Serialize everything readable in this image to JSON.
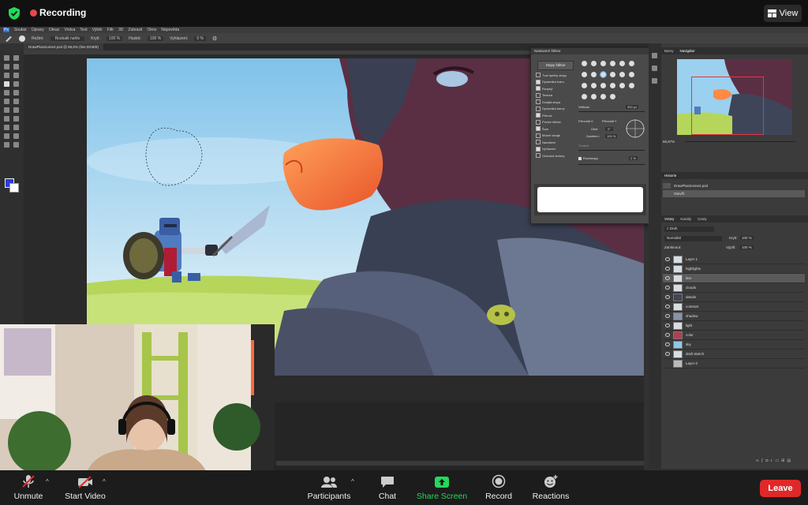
{
  "zoom": {
    "recording_label": "Recording",
    "view_label": "View",
    "toolbar": {
      "unmute": "Unmute",
      "start_video": "Start Video",
      "participants": "Participants",
      "chat": "Chat",
      "share_screen": "Share Screen",
      "record": "Record",
      "reactions": "Reactions",
      "leave": "Leave"
    },
    "colors": {
      "recording": "#e5484d",
      "share_screen": "#23d959",
      "leave": "#e02828"
    }
  },
  "photoshop": {
    "menu": [
      "Soubor",
      "Úpravy",
      "Obraz",
      "Vrstva",
      "Text",
      "Výběr",
      "Filtr",
      "3D",
      "Zobrazit",
      "Okno",
      "Nápověda"
    ],
    "options_bar": [
      "Režim:",
      "Rozbalit nahlo",
      "Krytí:",
      "100 %",
      "Hustot:",
      "100 %",
      "Vyhlazení:",
      "0 %"
    ],
    "document_tab": "DrawPlusScene2.psd @ 66,6% (line,RGB/8)",
    "foreground_color": "#2d3bd6",
    "brush_panel": {
      "title": "Nastavení štětce",
      "presets_button": "Stopy štětce",
      "options": [
        {
          "label": "Tvar špičky stopy",
          "checked": false
        },
        {
          "label": "Dynamika tvaru",
          "checked": true
        },
        {
          "label": "Rozptyl",
          "checked": true
        },
        {
          "label": "Textura",
          "checked": false
        },
        {
          "label": "Dvojitá stopa",
          "checked": false
        },
        {
          "label": "Dynamika barvy",
          "checked": false
        },
        {
          "label": "Přenos",
          "checked": true
        },
        {
          "label": "Pozice štětce",
          "checked": false
        },
        {
          "label": "Šum",
          "checked": true
        },
        {
          "label": "Mokré okraje",
          "checked": false
        },
        {
          "label": "Nanášení",
          "checked": false
        },
        {
          "label": "Vyhlazení",
          "checked": true
        },
        {
          "label": "Ochrana textury",
          "checked": false
        }
      ],
      "size_label": "Velikost",
      "size_value": "300 px",
      "flip_x": "Převrátit X",
      "flip_y": "Převrátit Y",
      "angle_label": "Úhel:",
      "angle_value": "0°",
      "roundness_label": "Zaoblení:",
      "roundness_value": "100 %",
      "hardness_label": "Tvrdost",
      "spacing_label": "Rozestupy",
      "spacing_value": "2 %"
    },
    "panel_tabs": {
      "top": [
        "Barvy",
        "Navigátor"
      ],
      "history": [
        "Historie"
      ],
      "history_items": [
        "DrawPlusScene2.psd",
        "Otevřít"
      ],
      "layers": [
        "Vrstvy",
        "Kanály",
        "Cesty"
      ]
    },
    "navigator_zoom": "66,67%",
    "layers": {
      "filter": "Druh",
      "blend_mode": "Normální",
      "opacity_label": "Krytí:",
      "opacity_value": "100 %",
      "lock_label": "Zamknout:",
      "fill_label": "Výplň:",
      "fill_value": "100 %",
      "items": [
        {
          "name": "Layer 1",
          "selected": false
        },
        {
          "name": "highlights",
          "selected": false
        },
        {
          "name": "line",
          "selected": true
        },
        {
          "name": "clouds",
          "selected": false
        },
        {
          "name": "details",
          "selected": false
        },
        {
          "name": "contrast",
          "selected": false
        },
        {
          "name": "shadow",
          "selected": false
        },
        {
          "name": "light",
          "selected": false
        },
        {
          "name": "color",
          "selected": false
        },
        {
          "name": "sky",
          "selected": false
        },
        {
          "name": "draft sketch",
          "selected": false
        },
        {
          "name": "Layer 0",
          "selected": false
        }
      ]
    }
  }
}
